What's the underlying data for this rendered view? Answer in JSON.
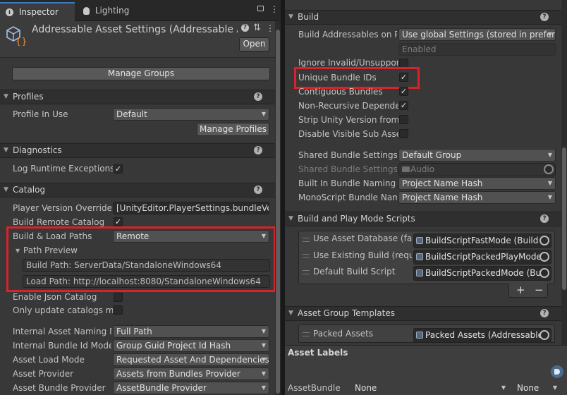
{
  "tabs": {
    "inspector": "Inspector",
    "lighting": "Lighting"
  },
  "header": {
    "title": "Addressable Asset Settings (Addressable Asse",
    "open_button": "Open"
  },
  "manage_groups_button": "Manage Groups",
  "profiles": {
    "title": "Profiles",
    "profile_in_use_label": "Profile In Use",
    "profile_value": "Default",
    "manage_profiles_button": "Manage Profiles"
  },
  "diagnostics": {
    "title": "Diagnostics",
    "log_runtime_exceptions_label": "Log Runtime Exceptions",
    "log_runtime_exceptions_checked": true
  },
  "catalog": {
    "title": "Catalog",
    "player_version_override_label": "Player Version Override",
    "player_version_override_value": "[UnityEditor.PlayerSettings.bundleVers",
    "build_remote_catalog_label": "Build Remote Catalog",
    "build_remote_catalog_checked": true,
    "build_load_paths_label": "Build & Load Paths",
    "build_load_paths_value": "Remote",
    "path_preview_label": "Path Preview",
    "build_path": "Build Path: ServerData/StandaloneWindows64",
    "load_path": "Load Path: http://localhost:8080/StandaloneWindows64",
    "enable_json_catalog_label": "Enable Json Catalog",
    "only_update_catalogs_label": "Only update catalogs ma"
  },
  "bundle_options": {
    "internal_asset_naming_label": "Internal Asset Naming M",
    "internal_asset_naming_value": "Full Path",
    "internal_bundle_id_label": "Internal Bundle Id Mode",
    "internal_bundle_id_value": "Group Guid Project Id Hash",
    "asset_load_mode_label": "Asset Load Mode",
    "asset_load_mode_value": "Requested Asset And Dependencies",
    "asset_provider_label": "Asset Provider",
    "asset_provider_value": "Assets from Bundles Provider",
    "asset_bundle_provider_label": "Asset Bundle Provider",
    "asset_bundle_provider_value": "AssetBundle Provider"
  },
  "build": {
    "title": "Build",
    "build_addressables_label": "Build Addressables on Pl",
    "build_addressables_value": "Use global Settings (stored in prefer",
    "enabled_value": "Enabled",
    "ignore_invalid_label": "Ignore Invalid/Unsupport",
    "unique_bundle_ids_label": "Unique Bundle IDs",
    "unique_bundle_ids_checked": true,
    "contiguous_bundles_label": "Contiguous Bundles",
    "contiguous_bundles_checked": true,
    "non_recursive_label": "Non-Recursive Depende",
    "non_recursive_checked": true,
    "strip_unity_version_label": "Strip Unity Version from",
    "disable_visible_sub_label": "Disable Visible Sub Asse",
    "shared_bundle_settings_label": "Shared Bundle Settings",
    "shared_bundle_settings_value": "Default Group",
    "shared_bundle_settings_group_label": "Shared Bundle Settings G",
    "shared_bundle_settings_group_value": "Audio",
    "built_in_bundle_naming_label": "Built In Bundle Naming Pr",
    "built_in_bundle_naming_value": "Project Name Hash",
    "monoscript_bundle_naming_label": "MonoScript Bundle Nami",
    "monoscript_bundle_naming_value": "Project Name Hash"
  },
  "build_play_mode_scripts": {
    "title": "Build and Play Mode Scripts",
    "items": [
      {
        "label": "Use Asset Database (fas",
        "value": "BuildScriptFastMode (Build S"
      },
      {
        "label": "Use Existing Build (requi",
        "value": "BuildScriptPackedPlayMode"
      },
      {
        "label": "Default Build Script",
        "value": "BuildScriptPackedMode (Bui"
      }
    ],
    "add_button": "+",
    "remove_button": "−"
  },
  "asset_group_templates": {
    "title": "Asset Group Templates",
    "item_label": "Packed Assets",
    "item_value": "Packed Assets (Addressable"
  },
  "asset_labels": {
    "title": "Asset Labels",
    "assetbundle_label": "AssetBundle",
    "value1": "None",
    "value2": "None"
  },
  "colors": {
    "highlight": "#d8232a",
    "accent": "#3a79bb"
  }
}
